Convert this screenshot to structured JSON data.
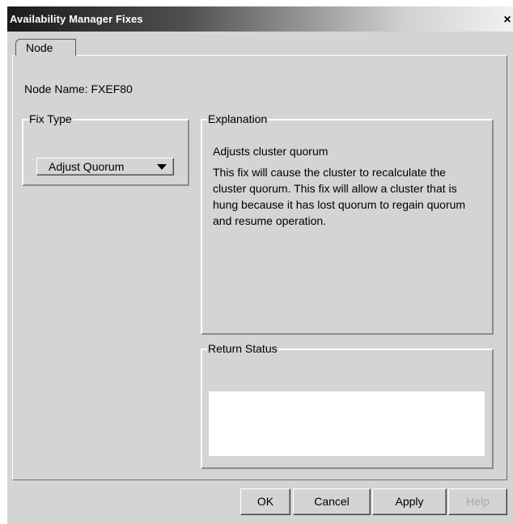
{
  "window": {
    "title": "Availability Manager Fixes",
    "close_glyph": "×"
  },
  "tab": {
    "label": "Node"
  },
  "node": {
    "label": "Node Name:",
    "value": "FXEF80",
    "full": "Node Name:  FXEF80"
  },
  "fix_type": {
    "legend": "Fix Type",
    "selected": "Adjust Quorum"
  },
  "explanation": {
    "legend": "Explanation",
    "heading": "Adjusts cluster quorum",
    "body": "This fix will cause the cluster to recalculate the cluster quorum. This fix will allow a cluster that is hung because it has lost quorum to regain quorum and resume operation."
  },
  "return_status": {
    "legend": "Return Status",
    "value": ""
  },
  "buttons": {
    "ok": "OK",
    "cancel": "Cancel",
    "apply": "Apply",
    "help": "Help"
  }
}
